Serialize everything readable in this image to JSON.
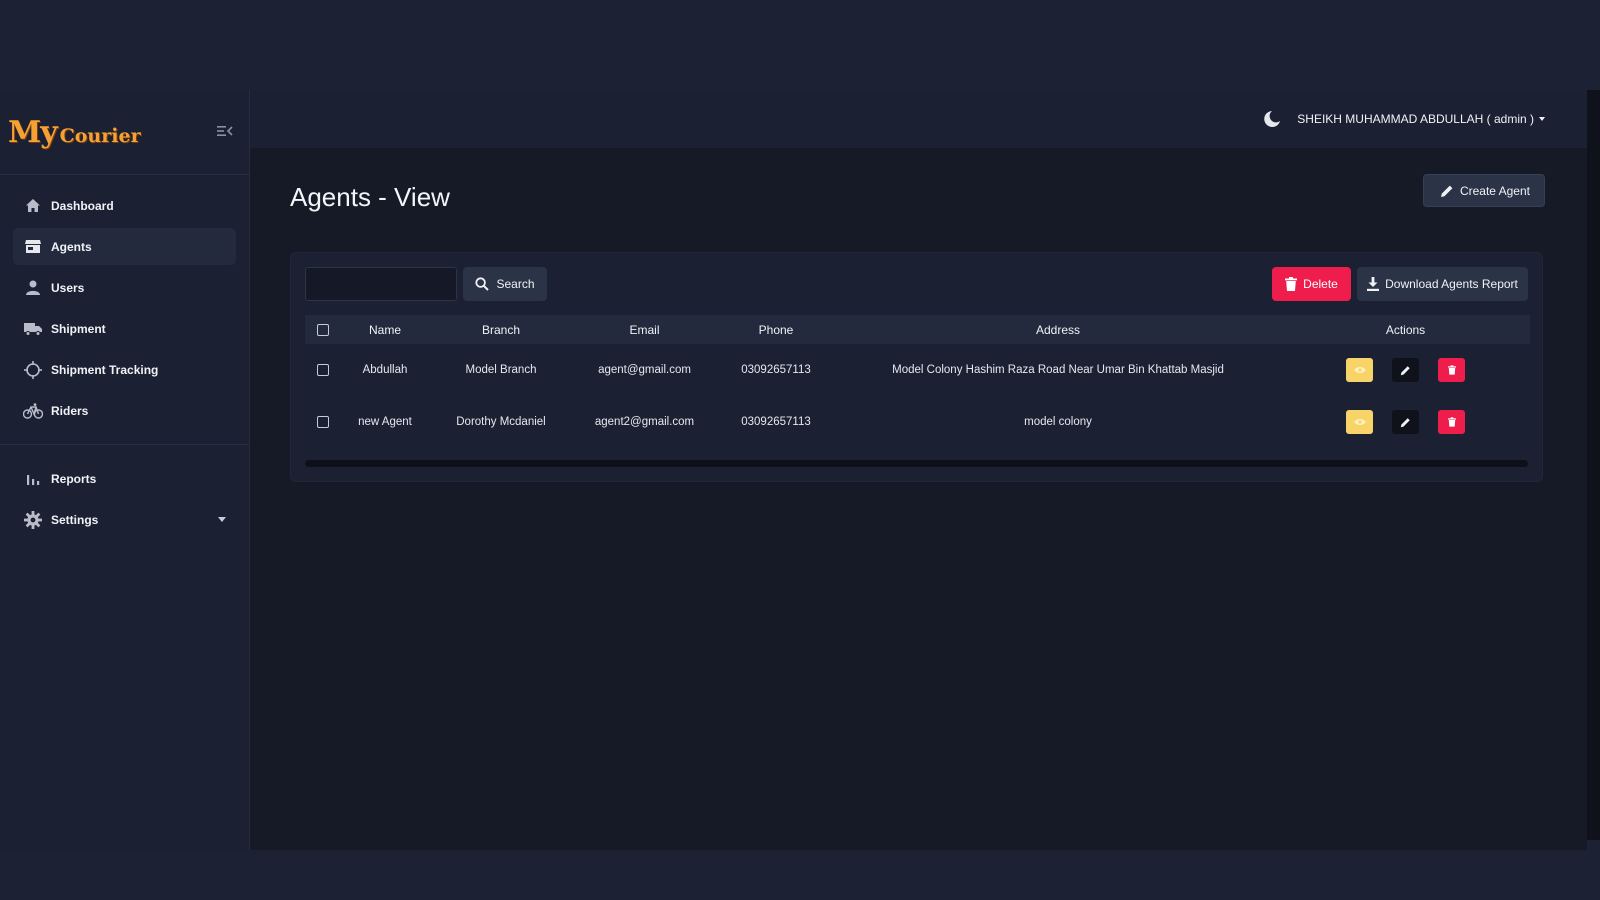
{
  "brand": {
    "logo_my": "My",
    "logo_courier": "Courier"
  },
  "sidebar": {
    "items": [
      {
        "label": "Dashboard",
        "icon": "home-icon"
      },
      {
        "label": "Agents",
        "icon": "store-icon",
        "active": true
      },
      {
        "label": "Users",
        "icon": "user-icon"
      },
      {
        "label": "Shipment",
        "icon": "truck-icon"
      },
      {
        "label": "Shipment Tracking",
        "icon": "crosshair-icon"
      },
      {
        "label": "Riders",
        "icon": "bicycle-icon"
      }
    ],
    "items2": [
      {
        "label": "Reports",
        "icon": "bar-chart-icon"
      },
      {
        "label": "Settings",
        "icon": "gear-icon",
        "has_dropdown": true
      }
    ]
  },
  "header": {
    "user": "SHEIKH MUHAMMAD ABDULLAH ( admin )",
    "theme_icon": "moon-icon"
  },
  "page": {
    "title": "Agents - View",
    "create_label": "Create Agent"
  },
  "toolbar": {
    "search_value": "",
    "search_label": "Search",
    "delete_label": "Delete",
    "download_label": "Download Agents Report"
  },
  "table": {
    "columns": [
      "Name",
      "Branch",
      "Email",
      "Phone",
      "Address",
      "Actions"
    ],
    "rows": [
      {
        "name": "Abdullah",
        "branch": "Model Branch",
        "email": "agent@gmail.com",
        "phone": "03092657113",
        "address": "Model Colony Hashim Raza Road Near Umar Bin Khattab Masjid"
      },
      {
        "name": "new Agent",
        "branch": "Dorothy Mcdaniel",
        "email": "agent2@gmail.com",
        "phone": "03092657113",
        "address": "model colony"
      }
    ]
  },
  "colors": {
    "accent_red": "#ee1d4b",
    "accent_yellow": "#f8d468",
    "logo_orange": "#f5a133",
    "bg_dark": "#161a27",
    "panel": "#1b2133"
  }
}
